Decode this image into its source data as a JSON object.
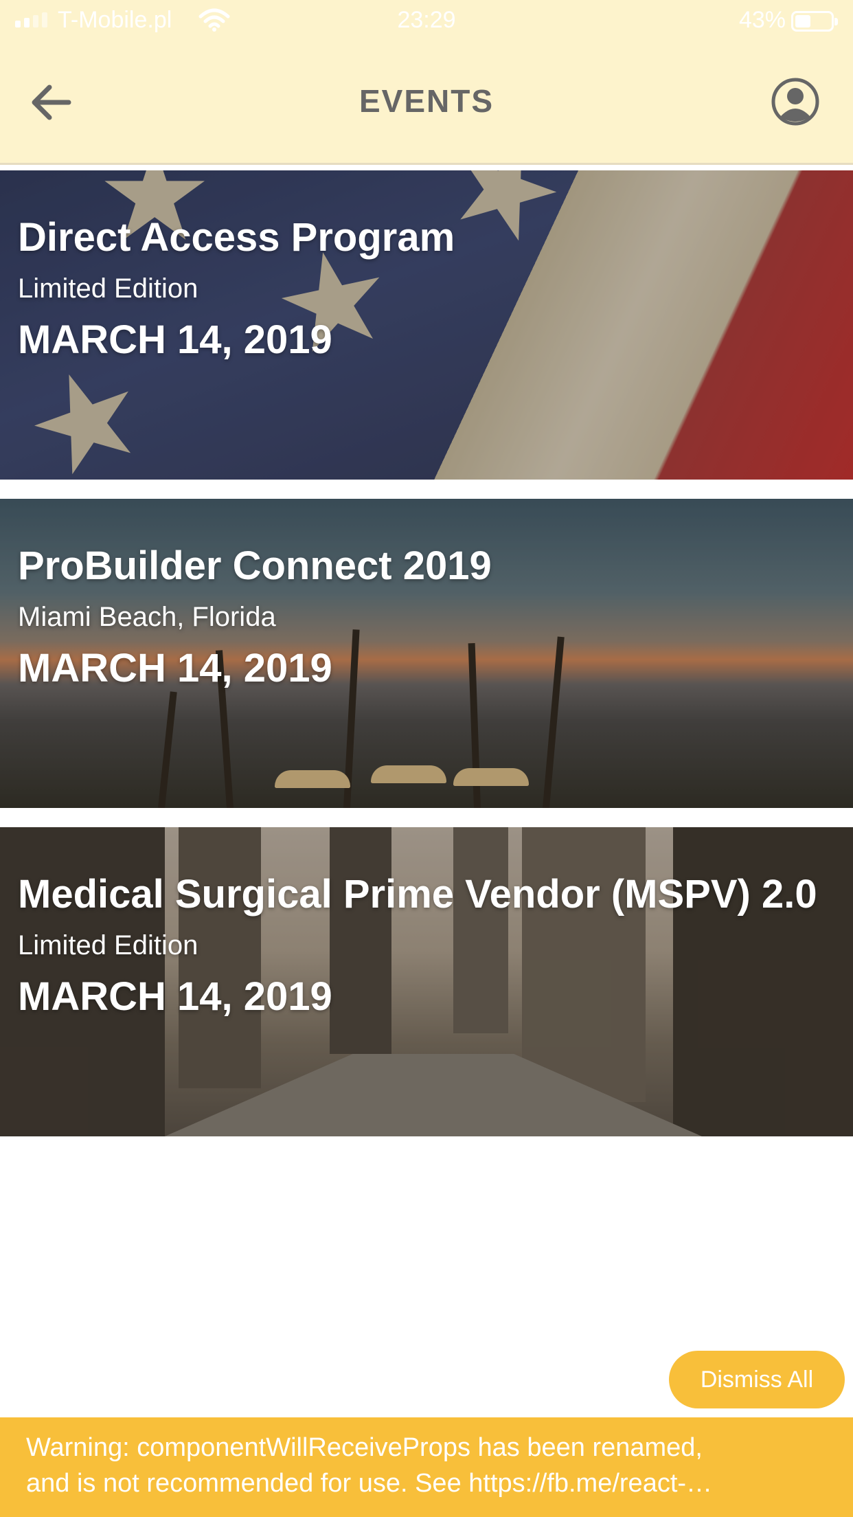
{
  "status_bar": {
    "carrier": "T-Mobile.pl",
    "time": "23:29",
    "battery_percent": "43%",
    "battery_level": 0.43
  },
  "header": {
    "title": "EVENTS",
    "back_icon": "arrow-left-icon",
    "profile_icon": "user-circle-icon"
  },
  "events": [
    {
      "title": "Direct Access Program",
      "subtitle": "Limited Edition",
      "date": "MARCH 14, 2019"
    },
    {
      "title": "ProBuilder Connect 2019",
      "subtitle": "Miami Beach, Florida",
      "date": "MARCH 14, 2019"
    },
    {
      "title": "Medical Surgical Prime Vendor (MSPV) 2.0",
      "subtitle": "Limited Edition",
      "date": "MARCH 14, 2019"
    }
  ],
  "dismiss_all_label": "Dismiss All",
  "warning": {
    "line1": "Warning: componentWillReceiveProps has been renamed,",
    "line2": "and is not recommended for use. See https://fb.me/react-…"
  },
  "colors": {
    "header_bg": "#fdf3cc",
    "header_text": "#666666",
    "accent": "#f8bf3a"
  }
}
